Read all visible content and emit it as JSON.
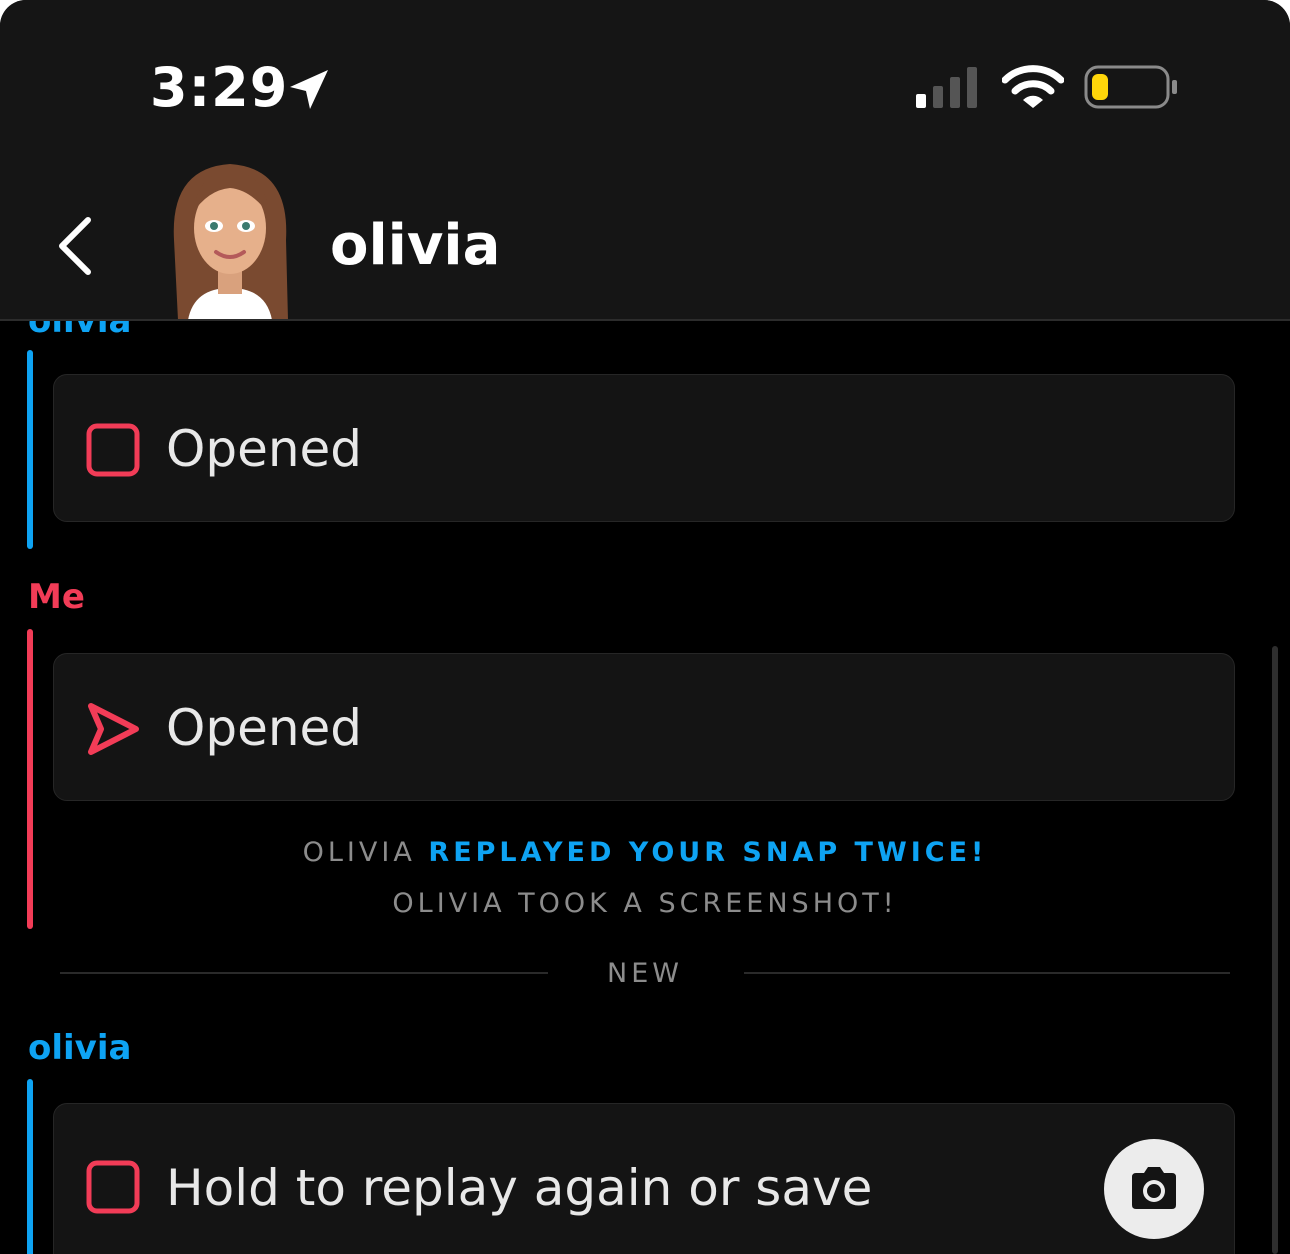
{
  "status_bar": {
    "time": "3:29",
    "location_icon": "location-arrow-icon",
    "signal_icon": "cellular-signal-icon",
    "wifi_icon": "wifi-icon",
    "battery_icon": "battery-low-icon"
  },
  "header": {
    "title": "olivia",
    "back_icon": "chevron-left-icon"
  },
  "messages": [
    {
      "sender": "olivia",
      "text": "Opened",
      "icon": "unopened-square-icon"
    },
    {
      "sender": "Me",
      "text": "Opened",
      "icon": "sent-arrow-icon"
    }
  ],
  "system_notes": {
    "replayed_name": "OLIVIA",
    "replayed_text": "REPLAYED YOUR SNAP TWICE!",
    "screenshot_text": "OLIVIA TOOK A SCREENSHOT!"
  },
  "divider_label": "NEW",
  "latest_message": {
    "sender": "olivia",
    "text": "Hold to replay again or save",
    "icon": "unopened-square-icon",
    "action_icon": "camera-icon"
  },
  "colors": {
    "friend": "#0ea3f3",
    "me": "#f23c57",
    "card_bg": "#141414",
    "header_bg": "#151515",
    "battery_fill": "#ffd60a"
  }
}
